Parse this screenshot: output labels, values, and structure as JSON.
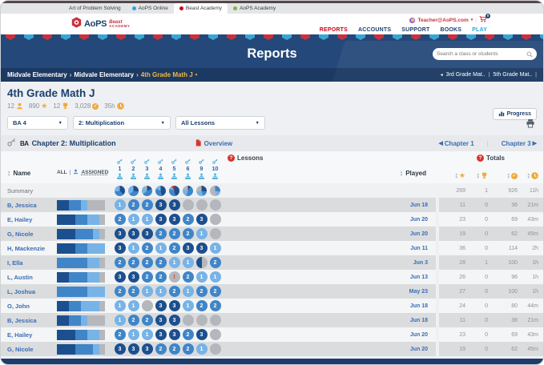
{
  "browser": {
    "tabs": [
      {
        "label": "Art of Problem Solving",
        "icon_color": "",
        "active": false
      },
      {
        "label": "AoPS Online",
        "icon_color": "#29a8dc",
        "active": false
      },
      {
        "label": "Beast Academy",
        "icon_color": "#d0021b",
        "active": true
      },
      {
        "label": "AoPS Academy",
        "icon_color": "#7ab648",
        "active": false
      }
    ]
  },
  "header": {
    "logo_main": "AoPS",
    "logo_beast": "Beast",
    "logo_academy": "ACADEMY",
    "account_email": "Teacher@AoPS.com",
    "cart_count": "0",
    "nav": [
      {
        "label": "REPORTS",
        "active": true,
        "play": false
      },
      {
        "label": "ACCOUNTS",
        "active": false,
        "play": false
      },
      {
        "label": "SUPPORT",
        "active": false,
        "play": false
      },
      {
        "label": "BOOKS",
        "active": false,
        "play": false
      },
      {
        "label": "PLAY",
        "active": false,
        "play": true
      }
    ]
  },
  "banner": {
    "title": "Reports",
    "search_placeholder": "Search a class or students"
  },
  "breadcrumb": {
    "items": [
      "Midvale Elementary",
      "Midvale Elementary",
      "4th Grade Math J"
    ],
    "siblings": [
      "3rd Grade Mat..",
      "5th Grade Mat.."
    ]
  },
  "page": {
    "title": "4th Grade Math J",
    "stats": [
      {
        "value": "12",
        "icon": "members-icon"
      },
      {
        "value": "890",
        "icon": "star-icon"
      },
      {
        "value": "12",
        "icon": "trophy-icon"
      },
      {
        "value": "3,028",
        "icon": "check-icon"
      },
      {
        "value": "35h",
        "icon": "clock-icon"
      }
    ],
    "progress_label": "Progress"
  },
  "filters": {
    "selects": [
      {
        "name": "ba-level-select",
        "value": "BA 4"
      },
      {
        "name": "chapter-select",
        "value": "2: Multiplication"
      },
      {
        "name": "lesson-select",
        "value": "All Lessons"
      }
    ]
  },
  "chapter": {
    "title": "Chapter 2: Multiplication",
    "logo": "BA",
    "overview_label": "Overview",
    "prev_label": "Chapter 1",
    "next_label": "Chapter 3"
  },
  "table": {
    "name_header": "Name",
    "all_label": "ALL",
    "assigned_label": "ASSIGNED",
    "lessons_header": "Lessons",
    "played_header": "Played",
    "totals_header": "Totals",
    "lesson_numbers": [
      "1",
      "2",
      "3",
      "4",
      "5",
      "6",
      "9",
      "10"
    ],
    "summary_pies": [
      [
        [
          "d",
          37
        ],
        [
          "m",
          36
        ],
        [
          "l",
          27
        ]
      ],
      [
        [
          "d",
          27
        ],
        [
          "m",
          37
        ],
        [
          "l",
          36
        ]
      ],
      [
        [
          "d",
          18
        ],
        [
          "m",
          46
        ],
        [
          "l",
          27
        ],
        [
          "g",
          9
        ]
      ],
      [
        [
          "d",
          46
        ],
        [
          "m",
          36
        ],
        [
          "l",
          18
        ]
      ],
      [
        [
          "d",
          46
        ],
        [
          "m",
          36
        ],
        [
          "l",
          9
        ],
        [
          "r",
          9
        ]
      ],
      [
        [
          "d",
          9
        ],
        [
          "m",
          46
        ],
        [
          "l",
          27
        ],
        [
          "g",
          18
        ]
      ],
      [
        [
          "d",
          27
        ],
        [
          "m",
          18
        ],
        [
          "l",
          28
        ],
        [
          "g",
          27
        ]
      ],
      [
        [
          "m",
          27
        ],
        [
          "l",
          18
        ],
        [
          "g",
          55
        ]
      ]
    ],
    "rows": [
      {
        "name": "Summary",
        "type": "summary",
        "played": "",
        "star": "269",
        "trophy": "1",
        "check": "926",
        "time": "11h"
      },
      {
        "name": "B, Jessica",
        "cells": [
          "1",
          "2",
          "2",
          "3",
          "3",
          "-",
          "-",
          "-"
        ],
        "played": "Jun 18",
        "star": "11",
        "trophy": "0",
        "check": "36",
        "time": "21m"
      },
      {
        "name": "E, Hailey",
        "cells": [
          "2",
          "1",
          "1",
          "3",
          "3",
          "2",
          "3",
          "-"
        ],
        "played": "Jun 20",
        "star": "23",
        "trophy": "0",
        "check": "69",
        "time": "43m"
      },
      {
        "name": "G, Nicole",
        "cells": [
          "3",
          "3",
          "3",
          "2",
          "2",
          "2",
          "1",
          "-"
        ],
        "played": "Jun 20",
        "star": "19",
        "trophy": "0",
        "check": "62",
        "time": "45m"
      },
      {
        "name": "H, Mackenzie",
        "cells": [
          "3",
          "1",
          "2",
          "1",
          "2",
          "3",
          "3",
          "1"
        ],
        "played": "Jun 11",
        "star": "36",
        "trophy": "0",
        "check": "114",
        "time": "2h"
      },
      {
        "name": "I, Ella",
        "cells": [
          "2",
          "2",
          "2",
          "2",
          "1",
          "1",
          "p",
          "2"
        ],
        "played": "Jun 3",
        "star": "28",
        "trophy": "1",
        "check": "100",
        "time": "1h"
      },
      {
        "name": "L, Austin",
        "cells": [
          "3",
          "3",
          "2",
          "2",
          "!",
          "2",
          "1",
          "1"
        ],
        "played": "Jun 13",
        "star": "26",
        "trophy": "0",
        "check": "96",
        "time": "1h"
      },
      {
        "name": "L, Joshua",
        "cells": [
          "2",
          "2",
          "1",
          "1",
          "2",
          "1",
          "2",
          "2"
        ],
        "played": "May 23",
        "star": "27",
        "trophy": "0",
        "check": "100",
        "time": "1h"
      },
      {
        "name": "O, John",
        "cells": [
          "1",
          "1",
          "-",
          "3",
          "3",
          "1",
          "2",
          "2"
        ],
        "played": "Jun 18",
        "star": "24",
        "trophy": "0",
        "check": "80",
        "time": "44m"
      },
      {
        "name": "B, Jessica",
        "cells": [
          "1",
          "2",
          "2",
          "3",
          "3",
          "-",
          "-",
          "-"
        ],
        "played": "Jun 18",
        "star": "11",
        "trophy": "0",
        "check": "36",
        "time": "21m"
      },
      {
        "name": "E, Hailey",
        "cells": [
          "2",
          "1",
          "1",
          "3",
          "3",
          "2",
          "3",
          "-"
        ],
        "played": "Jun 20",
        "star": "23",
        "trophy": "0",
        "check": "69",
        "time": "43m"
      },
      {
        "name": "G, Nicole",
        "cells": [
          "3",
          "3",
          "3",
          "2",
          "2",
          "2",
          "1",
          "-"
        ],
        "played": "Jun 20",
        "star": "19",
        "trophy": "0",
        "check": "62",
        "time": "45m"
      }
    ]
  },
  "colors": {
    "level3": "#1c4f8e",
    "level2": "#3f85c8",
    "level1": "#77b3e6",
    "unplayed": "#b4b7bb",
    "alert": "#d9342b",
    "accent_red": "#c9313c",
    "navy": "#1c3f6e",
    "gold": "#f0a93a",
    "link": "#3a6db5",
    "cyan": "#29a8dc",
    "pennant_blue": "#3aa5d4"
  }
}
